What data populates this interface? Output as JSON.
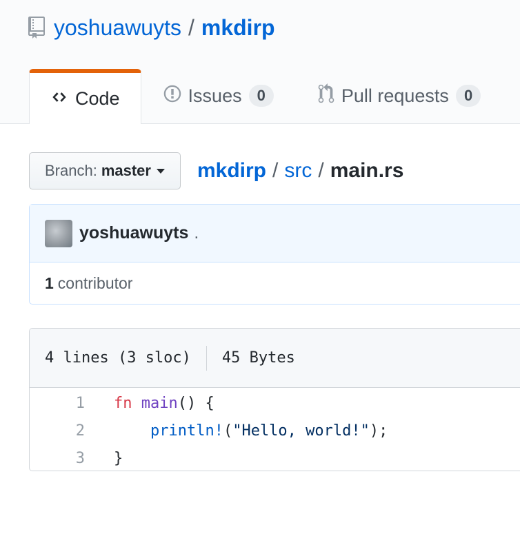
{
  "repo": {
    "owner": "yoshuawuyts",
    "separator": "/",
    "name": "mkdirp"
  },
  "tabs": [
    {
      "label": "Code",
      "icon": "code-icon",
      "selected": true
    },
    {
      "label": "Issues",
      "icon": "issue-opened-icon",
      "count": "0"
    },
    {
      "label": "Pull requests",
      "icon": "git-pull-request-icon",
      "count": "0"
    }
  ],
  "branch": {
    "label": "Branch:",
    "name": "master"
  },
  "breadcrumb": {
    "root": "mkdirp",
    "sep": "/",
    "dir": "src",
    "file": "main.rs"
  },
  "commit": {
    "author": "yoshuawuyts",
    "message": "."
  },
  "contributors": {
    "count": "1",
    "label": "contributor"
  },
  "file": {
    "lines_info": "4 lines (3 sloc)",
    "size": "45 Bytes",
    "lines": [
      {
        "num": "1",
        "kw": "fn",
        "fn": "main",
        "rest": "() {"
      },
      {
        "num": "2",
        "indent": "    ",
        "macro": "println!",
        "open": "(",
        "str": "\"Hello, world!\"",
        "close": ");"
      },
      {
        "num": "3",
        "rest": "}"
      }
    ]
  },
  "colors": {
    "link": "#0366d6",
    "tab_accent": "#e36209",
    "keyword": "#d73a49",
    "function": "#6f42c1",
    "macro": "#005cc5",
    "string": "#032f62"
  }
}
